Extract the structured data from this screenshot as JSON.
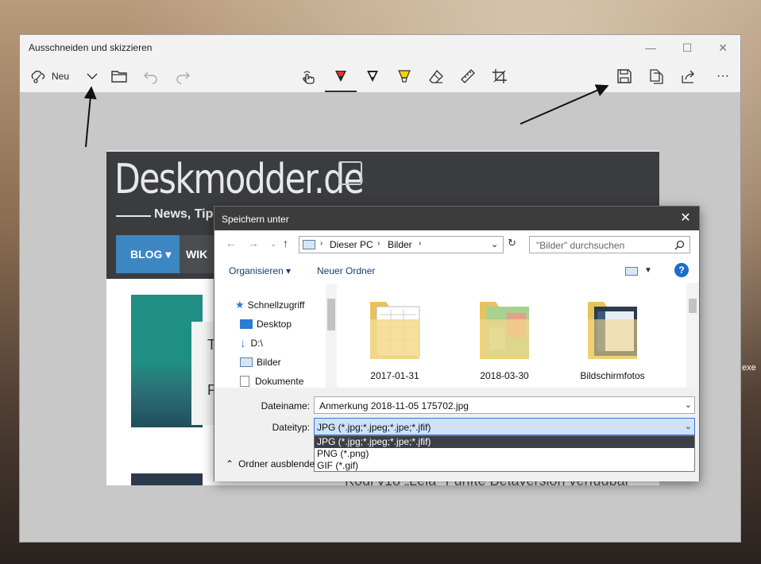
{
  "app": {
    "title": "Ausschneiden und skizzieren",
    "window_controls": {
      "minimize": "—",
      "maximize": "☐",
      "close": "✕"
    },
    "toolbar": {
      "new_label": "Neu",
      "more": "···"
    }
  },
  "screenshot": {
    "logo": "Deskmodder.de",
    "tagline": "News, Tip",
    "nav": {
      "blog": "BLOG ▾",
      "wiki": "WIK"
    },
    "card_t": "T",
    "card_p": "P",
    "bottom_text": "Kodi v18 „Leia\" Fünfte Betaversion verfügbar"
  },
  "dialog": {
    "title": "Speichern unter",
    "close": "✕",
    "breadcrumb": [
      "Dieser PC",
      "Bilder"
    ],
    "search_placeholder": "\"Bilder\" durchsuchen",
    "commands": {
      "organize": "Organisieren ▾",
      "new_folder": "Neuer Ordner",
      "help": "?"
    },
    "nav_pane": [
      {
        "label": "Schnellzugriff",
        "icon": "star-icon"
      },
      {
        "label": "Desktop",
        "icon": "desktop-icon"
      },
      {
        "label": "D:\\",
        "icon": "download-icon"
      },
      {
        "label": "Bilder",
        "icon": "pictures-icon"
      },
      {
        "label": "Dokumente",
        "icon": "document-icon"
      }
    ],
    "folders": [
      "2017-01-31",
      "2018-03-30",
      "Bildschirmfotos"
    ],
    "filename_label": "Dateiname:",
    "filename_value": "Anmerkung 2018-11-05 175702.jpg",
    "filetype_label": "Dateityp:",
    "filetype_value": "JPG (*.jpg;*.jpeg;*.jpe;*.jfif)",
    "filetype_options": [
      "JPG (*.jpg;*.jpeg;*.jpe;*.jfif)",
      "PNG (*.png)",
      "GIF (*.gif)"
    ],
    "hide_folders": "Ordner ausblende"
  },
  "desktop_label": "exe",
  "colors": {
    "pen_red": "#e0352b",
    "highlighter_yellow": "#f5d300",
    "blog_blue": "#3c86c2",
    "dialog_title": "#3c3c3c"
  }
}
